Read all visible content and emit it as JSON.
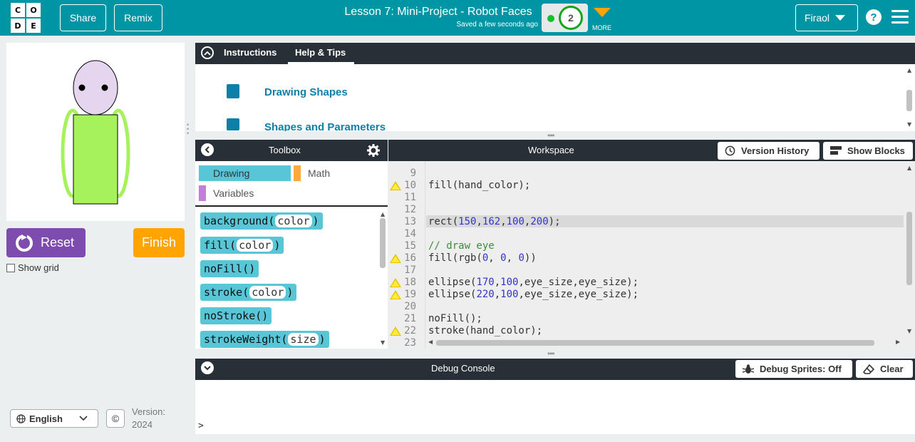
{
  "header": {
    "logo_letters": [
      "C",
      "O",
      "D",
      "E"
    ],
    "share_label": "Share",
    "remix_label": "Remix",
    "lesson_title": "Lesson 7: Mini-Project - Robot Faces",
    "saved_text": "Saved a few seconds ago",
    "progress_level": "2",
    "more_label": "MORE",
    "user_name": "Firaol",
    "help_label": "?"
  },
  "left": {
    "reset_label": "Reset",
    "finish_label": "Finish",
    "show_grid_label": "Show grid",
    "language": "English",
    "copyright_symbol": "©",
    "version_label": "Version:",
    "version_value": "2024"
  },
  "instructions": {
    "tabs": [
      "Instructions",
      "Help & Tips"
    ],
    "active_tab": "Help & Tips",
    "tips": [
      "Drawing Shapes",
      "Shapes and Parameters"
    ]
  },
  "toolbox": {
    "title": "Toolbox",
    "categories": [
      {
        "label": "Drawing",
        "color": "#59c6d8"
      },
      {
        "label": "Math",
        "color": "#ffa93b"
      },
      {
        "label": "Variables",
        "color": "#c27ed8"
      }
    ],
    "blocks": [
      {
        "fn": "background",
        "param": "color"
      },
      {
        "fn": "fill",
        "param": "color"
      },
      {
        "fn": "noFill",
        "param": ""
      },
      {
        "fn": "stroke",
        "param": "color"
      },
      {
        "fn": "noStroke",
        "param": ""
      },
      {
        "fn": "strokeWeight",
        "param": "size"
      }
    ]
  },
  "workspace": {
    "title": "Workspace",
    "version_history_label": "Version History",
    "show_blocks_label": "Show Blocks",
    "lines": [
      {
        "n": "9",
        "code": "",
        "warn": false
      },
      {
        "n": "10",
        "code": "fill(hand_color);",
        "warn": true
      },
      {
        "n": "11",
        "code": "",
        "warn": false
      },
      {
        "n": "12",
        "code": "",
        "warn": false
      },
      {
        "n": "13",
        "code": "rect(150,162,100,200);",
        "warn": false
      },
      {
        "n": "14",
        "code": "",
        "warn": false
      },
      {
        "n": "15",
        "code": "// draw eye",
        "warn": false
      },
      {
        "n": "16",
        "code": "fill(rgb(0, 0, 0))",
        "warn": true
      },
      {
        "n": "17",
        "code": "",
        "warn": false
      },
      {
        "n": "18",
        "code": "ellipse(170,100,eye_size,eye_size);",
        "warn": true
      },
      {
        "n": "19",
        "code": "ellipse(220,100,eye_size,eye_size);",
        "warn": true
      },
      {
        "n": "20",
        "code": "",
        "warn": false
      },
      {
        "n": "21",
        "code": "noFill();",
        "warn": false
      },
      {
        "n": "22",
        "code": "stroke(hand_color);",
        "warn": true
      },
      {
        "n": "23",
        "code": "",
        "warn": false
      }
    ]
  },
  "console": {
    "title": "Debug Console",
    "debug_sprites_label": "Debug Sprites: Off",
    "clear_label": "Clear",
    "prompt": ">"
  },
  "colors": {
    "header_bg": "#0095a5",
    "dark_bar": "#292f36",
    "reset_purple": "#7e4cae",
    "finish_orange": "#ffa400",
    "robot_head": "#e6d5ef",
    "robot_body": "#a6f25c"
  }
}
